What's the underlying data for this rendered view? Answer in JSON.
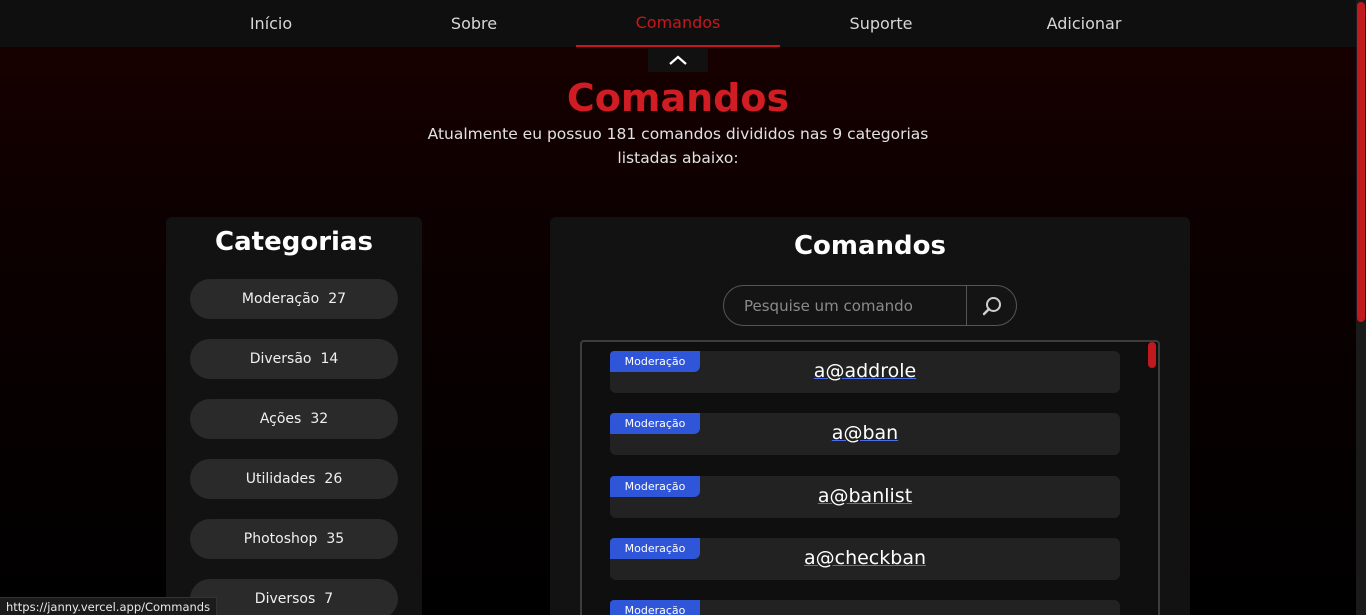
{
  "nav": {
    "items": [
      {
        "label": "Início"
      },
      {
        "label": "Sobre"
      },
      {
        "label": "Comandos"
      },
      {
        "label": "Suporte"
      },
      {
        "label": "Adicionar"
      }
    ],
    "active": "Comandos"
  },
  "hero": {
    "title": "Comandos",
    "description": "Atualmente eu possuo 181 comandos divididos nas 9 categorias listadas abaixo:"
  },
  "categories": {
    "title": "Categorias",
    "items": [
      {
        "label": "Moderação",
        "count": "27"
      },
      {
        "label": "Diversão",
        "count": "14"
      },
      {
        "label": "Ações",
        "count": "32"
      },
      {
        "label": "Utilidades",
        "count": "26"
      },
      {
        "label": "Photoshop",
        "count": "35"
      },
      {
        "label": "Diversos",
        "count": "7"
      }
    ]
  },
  "commands": {
    "title": "Comandos",
    "search_placeholder": "Pesquise um comando",
    "items": [
      {
        "category": "Moderação",
        "name": "a@addrole"
      },
      {
        "category": "Moderação",
        "name": "a@ban"
      },
      {
        "category": "Moderação",
        "name": "a@banlist"
      },
      {
        "category": "Moderação",
        "name": "a@checkban"
      },
      {
        "category": "Moderação",
        "name": ""
      }
    ]
  },
  "status_bar": {
    "url": "https://janny.vercel.app/Commands"
  },
  "colors": {
    "accent": "#c8171c",
    "badge": "#2f55d9",
    "panel": "#121212"
  },
  "icons": {
    "collapse": "chevron-up-icon",
    "search": "search-icon"
  }
}
